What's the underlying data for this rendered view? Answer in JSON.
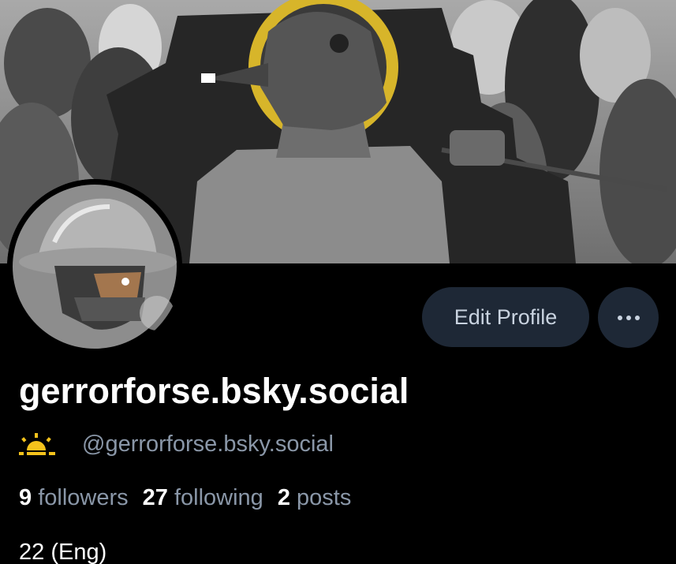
{
  "profile": {
    "display_name": "gerrorforse.bsky.social",
    "handle": "@gerrorforse.bsky.social",
    "handle_icon": "sunrise-icon",
    "bio": "22 (Eng)"
  },
  "stats": {
    "followers_count": "9",
    "followers_label": "followers",
    "following_count": "27",
    "following_label": "following",
    "posts_count": "2",
    "posts_label": "posts"
  },
  "actions": {
    "edit_label": "Edit Profile",
    "more_icon": "ellipsis-icon"
  },
  "colors": {
    "background": "#000000",
    "button_bg": "#1e2836",
    "muted_text": "#8a97a8",
    "accent_yellow": "#f4c21c",
    "halo_gold": "#d7b52a"
  }
}
